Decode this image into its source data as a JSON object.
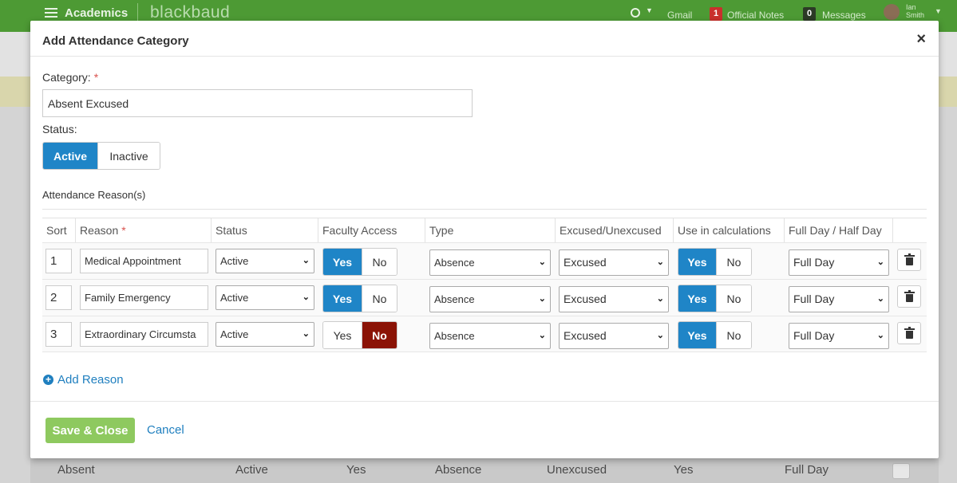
{
  "topbar": {
    "app_name": "Academics",
    "brand": "blackbaud",
    "gmail": "Gmail",
    "official_notes_count": "1",
    "official_notes": "Official Notes",
    "messages_count": "0",
    "messages": "Messages",
    "user_first": "Ian",
    "user_last": "Smith"
  },
  "background_row": {
    "name": "Absent",
    "status": "Active",
    "faculty_access": "Yes",
    "type": "Absence",
    "excused": "Unexcused",
    "use_in_calc": "Yes",
    "day": "Full Day"
  },
  "modal": {
    "title": "Add Attendance Category",
    "close": "×",
    "category_label": "Category:",
    "required_mark": "*",
    "category_value": "Absent Excused",
    "status_label": "Status:",
    "status_options": [
      "Active",
      "Inactive"
    ],
    "status_selected": "Active",
    "reasons_label": "Attendance Reason(s)",
    "columns": [
      "Sort",
      "Reason",
      "Status",
      "Faculty Access",
      "Type",
      "Excused/Unexcused",
      "Use in calculations",
      "Full Day / Half Day"
    ],
    "yes": "Yes",
    "no": "No",
    "rows": [
      {
        "sort": "1",
        "reason": "Medical Appointment",
        "status": "Active",
        "faculty_access": "Yes",
        "type": "Absence",
        "excused": "Excused",
        "use_in_calc": "Yes",
        "day": "Full Day"
      },
      {
        "sort": "2",
        "reason": "Family Emergency",
        "status": "Active",
        "faculty_access": "Yes",
        "type": "Absence",
        "excused": "Excused",
        "use_in_calc": "Yes",
        "day": "Full Day"
      },
      {
        "sort": "3",
        "reason": "Extraordinary Circumsta",
        "status": "Active",
        "faculty_access": "No",
        "type": "Absence",
        "excused": "Excused",
        "use_in_calc": "Yes",
        "day": "Full Day"
      }
    ],
    "add_reason": "Add Reason",
    "save_close": "Save & Close",
    "cancel": "Cancel"
  },
  "colors": {
    "topbar": "#4d9a34",
    "accent_blue": "#1f85c7",
    "danger_red": "#8b1306",
    "save_green": "#8ec95f",
    "link_blue": "#1f7fbf"
  }
}
